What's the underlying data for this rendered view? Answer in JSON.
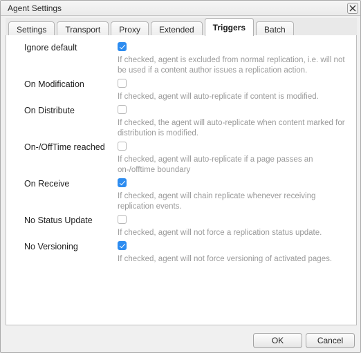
{
  "window": {
    "title": "Agent Settings",
    "close_icon": "close-x-icon"
  },
  "tabs": [
    {
      "label": "Settings",
      "active": false
    },
    {
      "label": "Transport",
      "active": false
    },
    {
      "label": "Proxy",
      "active": false
    },
    {
      "label": "Extended",
      "active": false
    },
    {
      "label": "Triggers",
      "active": true
    },
    {
      "label": "Batch",
      "active": false
    }
  ],
  "colors": {
    "checkbox_checked": "#2d8cf0",
    "description_text": "#9a9a9a",
    "window_chrome": "#f0f0f0"
  },
  "form": {
    "rows": [
      {
        "label": "Ignore default",
        "checked": true,
        "description": "If checked, agent is excluded from normal replication, i.e. will not be used if a content author issues a replication action."
      },
      {
        "label": "On Modification",
        "checked": false,
        "description": "If checked, agent will auto-replicate if content is modified."
      },
      {
        "label": "On Distribute",
        "checked": false,
        "description": "If checked, the agent will auto-replicate when content marked for distribution is modified."
      },
      {
        "label": "On-/OffTime reached",
        "checked": false,
        "description": "If checked, agent will auto-replicate if a page passes an on-/offtime boundary"
      },
      {
        "label": "On Receive",
        "checked": true,
        "description": "If checked, agent will chain replicate whenever receiving replication events."
      },
      {
        "label": "No Status Update",
        "checked": false,
        "description": "If checked, agent will not force a replication status update."
      },
      {
        "label": "No Versioning",
        "checked": true,
        "description": "If checked, agent will not force versioning of activated pages."
      }
    ]
  },
  "footer": {
    "ok_label": "OK",
    "cancel_label": "Cancel"
  }
}
